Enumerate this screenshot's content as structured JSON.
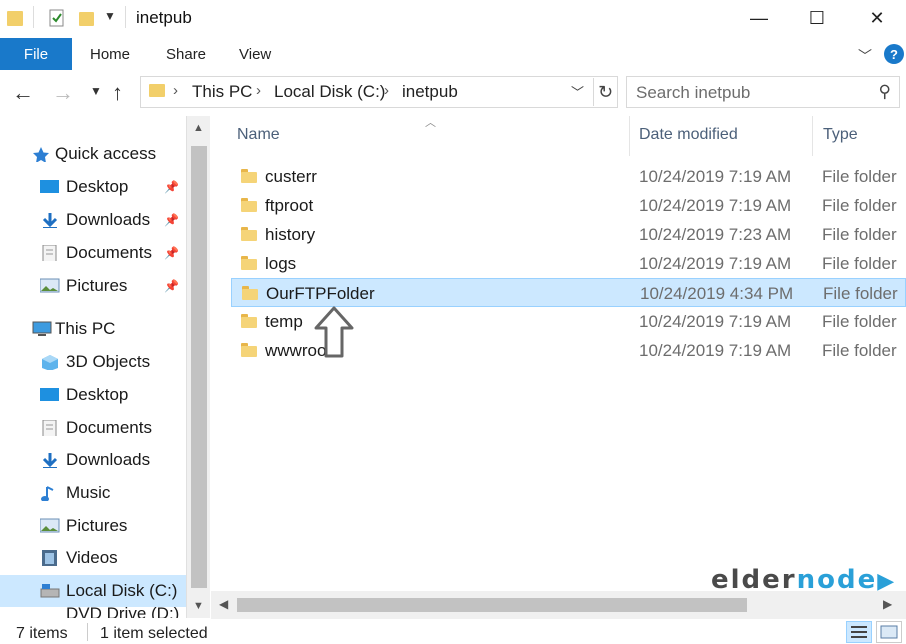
{
  "window": {
    "title": "inetpub",
    "minimize": "—",
    "maximize": "☐",
    "close": "✕"
  },
  "ribbon": {
    "tabs": [
      "File",
      "Home",
      "Share",
      "View"
    ],
    "help": "?"
  },
  "address": {
    "crumbs": [
      "This PC",
      "Local Disk (C:)",
      "inetpub"
    ],
    "search_placeholder": "Search inetpub"
  },
  "sidebar": {
    "items": [
      {
        "label": "Quick access",
        "icon": "star-icon"
      },
      {
        "label": "Desktop",
        "icon": "desktop-icon",
        "pinned": true
      },
      {
        "label": "Downloads",
        "icon": "download-icon",
        "pinned": true
      },
      {
        "label": "Documents",
        "icon": "document-icon",
        "pinned": true
      },
      {
        "label": "Pictures",
        "icon": "picture-icon",
        "pinned": true
      },
      {
        "label": "This PC",
        "icon": "computer-icon"
      },
      {
        "label": "3D Objects",
        "icon": "cube-icon"
      },
      {
        "label": "Desktop",
        "icon": "desktop-icon"
      },
      {
        "label": "Documents",
        "icon": "document-icon"
      },
      {
        "label": "Downloads",
        "icon": "download-icon"
      },
      {
        "label": "Music",
        "icon": "music-icon"
      },
      {
        "label": "Pictures",
        "icon": "picture-icon"
      },
      {
        "label": "Videos",
        "icon": "video-icon"
      },
      {
        "label": "Local Disk (C:)",
        "icon": "drive-icon",
        "selected": true
      },
      {
        "label": "DVD Drive (D:) C",
        "icon": "dvd-icon"
      }
    ]
  },
  "columns": {
    "name": "Name",
    "date": "Date modified",
    "type": "Type"
  },
  "files": [
    {
      "name": "custerr",
      "date": "10/24/2019 7:19 AM",
      "type": "File folder"
    },
    {
      "name": "ftproot",
      "date": "10/24/2019 7:19 AM",
      "type": "File folder"
    },
    {
      "name": "history",
      "date": "10/24/2019 7:23 AM",
      "type": "File folder"
    },
    {
      "name": "logs",
      "date": "10/24/2019 7:19 AM",
      "type": "File folder"
    },
    {
      "name": "OurFTPFolder",
      "date": "10/24/2019 4:34 PM",
      "type": "File folder",
      "selected": true
    },
    {
      "name": "temp",
      "date": "10/24/2019 7:19 AM",
      "type": "File folder"
    },
    {
      "name": "wwwroot",
      "date": "10/24/2019 7:19 AM",
      "type": "File folder"
    }
  ],
  "status": {
    "items": "7 items",
    "selection": "1 item selected"
  },
  "watermark": {
    "text_left": "elder",
    "text_right": "node"
  },
  "colors": {
    "accent": "#1979ca",
    "selection": "#cce8ff",
    "folder": "#f5d478"
  }
}
